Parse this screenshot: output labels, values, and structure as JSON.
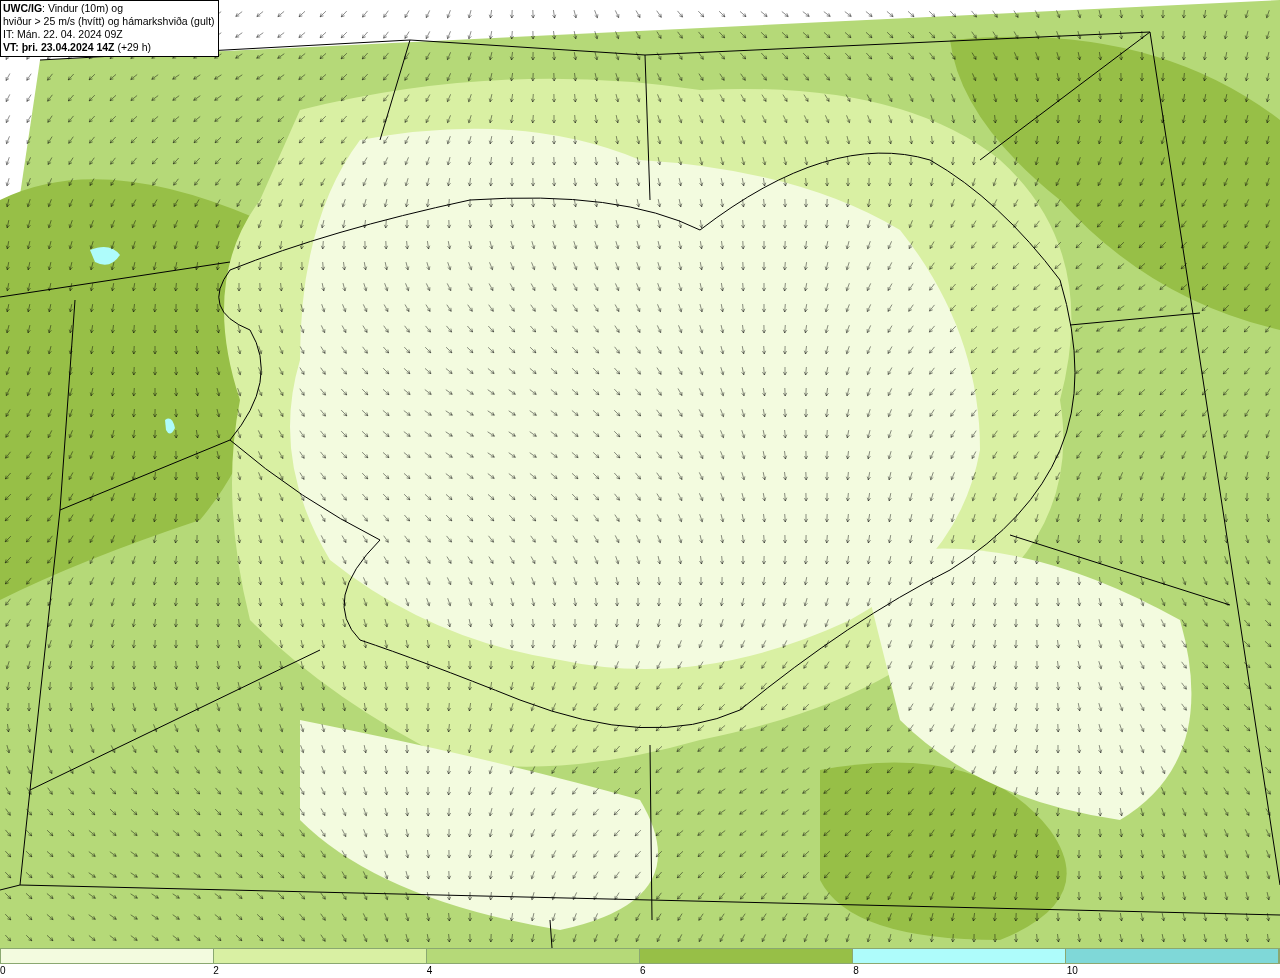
{
  "info_box": {
    "lines": [
      "**UWC/IG**: Vindur (10m) og",
      "hviður > 25 m/s (hvítt) og hámarkshviða (gult)",
      "IT: Mán. 22. 04. 2024 09Z",
      "**VT: þri. 23.04.2024 14Z** (+29 h)"
    ]
  },
  "legend": {
    "bins": [
      {
        "color": "#f3fbdf"
      },
      {
        "color": "#d9f0a3"
      },
      {
        "color": "#b5d978"
      },
      {
        "color": "#97bf47"
      },
      {
        "color": "#aefcfb"
      },
      {
        "color": "#7fd8d8"
      }
    ],
    "ticks": [
      "0",
      "2",
      "4",
      "6",
      "8",
      "10"
    ]
  }
}
